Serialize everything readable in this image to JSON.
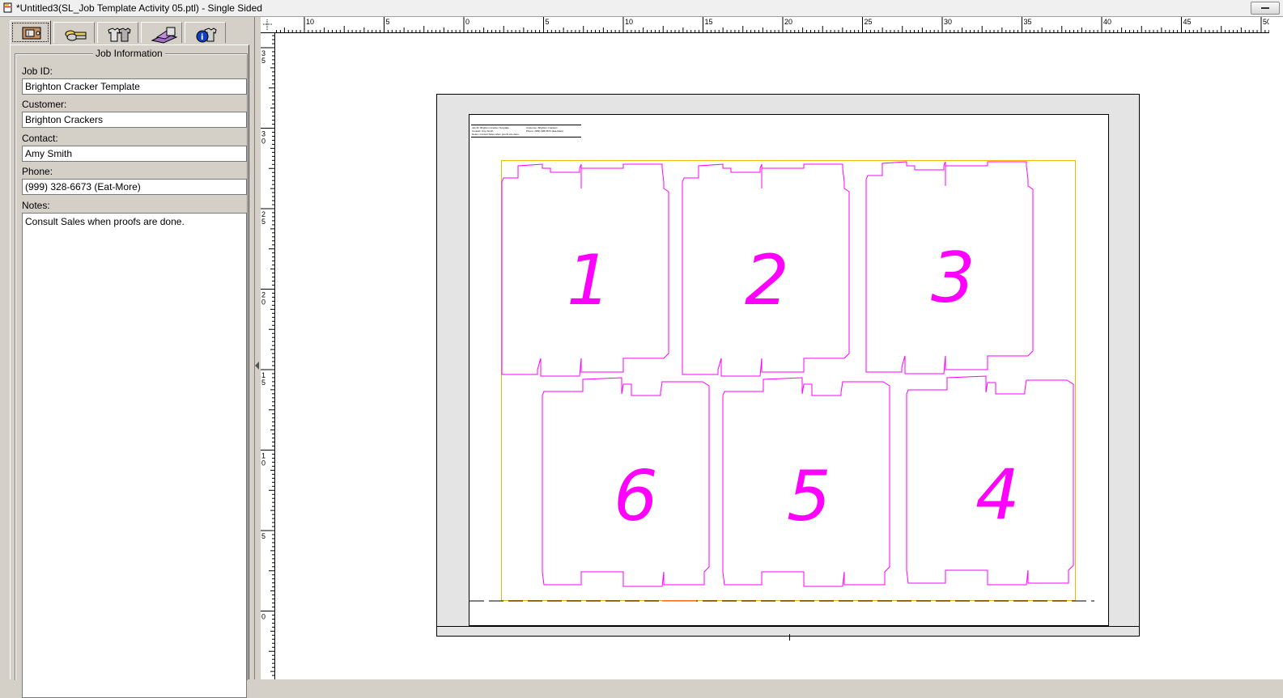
{
  "window": {
    "title": "*Untitled3(SL_Job Template Activity 05.ptl) - Single Sided"
  },
  "tabs": [
    {
      "name": "job-info",
      "icon": "job-tag-icon",
      "active": true
    },
    {
      "name": "keys",
      "icon": "keys-icon",
      "active": false
    },
    {
      "name": "products",
      "icon": "shirts-icon",
      "active": false
    },
    {
      "name": "stock",
      "icon": "boxes-icon",
      "active": false
    },
    {
      "name": "info",
      "icon": "info-shirt-icon",
      "active": false
    }
  ],
  "job_info": {
    "group_title": "Job Information",
    "job_id_label": "Job ID:",
    "job_id_value": "Brighton Cracker Template",
    "customer_label": "Customer:",
    "customer_value": "Brighton Crackers",
    "contact_label": "Contact:",
    "contact_value": "Amy Smith",
    "phone_label": "Phone:",
    "phone_value": "(999) 328-6673 (Eat-More)",
    "notes_label": "Notes:",
    "notes_value": "Consult Sales when proofs are done."
  },
  "rulers": {
    "horizontal_labels": [
      "10",
      "5",
      "0",
      "5",
      "10",
      "15",
      "20",
      "25",
      "30",
      "35",
      "40",
      "45",
      "50"
    ],
    "vertical_labels": [
      "35",
      "30",
      "25",
      "20",
      "15",
      "10",
      "5",
      "0"
    ]
  },
  "sheet_header": {
    "line1_left": "Job ID: Brighton Cracker Template",
    "line2_left": "Contact: Amy Smith",
    "line3_left": "Notes: Consult Sales when proofs are done.",
    "line1_right": "Customer: Brighton Crackers",
    "line2_right": "Phone: (999) 328-6673 (Eat-More)"
  },
  "layout_numbers": [
    "1",
    "2",
    "3",
    "6",
    "5",
    "4"
  ],
  "colors": {
    "die_line": "#ff00ff",
    "press_area": "#f0b800"
  }
}
